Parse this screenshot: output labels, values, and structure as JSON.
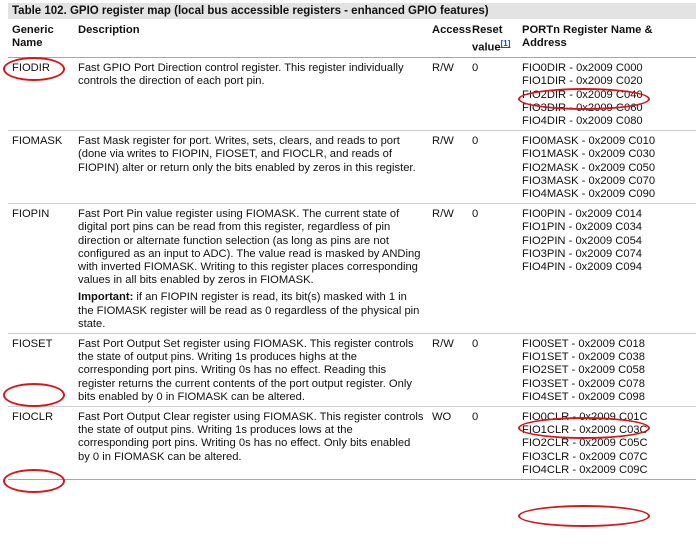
{
  "caption": "Table 102.  GPIO register map (local bus accessible registers - enhanced GPIO features)",
  "headers": {
    "generic_name": "Generic Name",
    "description": "Description",
    "access": "Access",
    "reset_value": "Reset value",
    "reset_ref": "[1]",
    "port_register": "PORTn Register Name & Address"
  },
  "rows": [
    {
      "name": "FIODIR",
      "description": [
        "Fast GPIO Port Direction control register. This register individually controls the direction of each port pin."
      ],
      "important": "",
      "important_text": "",
      "access": "R/W",
      "reset": "0",
      "addresses": [
        "FIO0DIR - 0x2009 C000",
        "FIO1DIR - 0x2009 C020",
        "FIO2DIR - 0x2009 C040",
        "FIO3DIR - 0x2009 C060",
        "FIO4DIR - 0x2009 C080"
      ]
    },
    {
      "name": "FIOMASK",
      "description": [
        "Fast Mask register for port. Writes, sets, clears, and reads to port (done via writes to FIOPIN, FIOSET, and FIOCLR, and reads of FIOPIN) alter or return only the bits enabled by zeros in this register."
      ],
      "important": "",
      "important_text": "",
      "access": "R/W",
      "reset": "0",
      "addresses": [
        "FIO0MASK - 0x2009 C010",
        "FIO1MASK - 0x2009 C030",
        "FIO2MASK - 0x2009 C050",
        "FIO3MASK - 0x2009 C070",
        "FIO4MASK - 0x2009 C090"
      ]
    },
    {
      "name": "FIOPIN",
      "description": [
        "Fast Port Pin value register using FIOMASK. The current state of digital port pins can be read from this register, regardless of pin direction or alternate function selection (as long as pins are not configured as an input to ADC). The value read is masked by ANDing with inverted FIOMASK. Writing to this register places corresponding values in all bits enabled by zeros in FIOMASK."
      ],
      "important": "Important:",
      "important_text": " if an FIOPIN register is read, its bit(s) masked with 1 in the FIOMASK register will be read as 0 regardless of the physical pin state.",
      "access": "R/W",
      "reset": "0",
      "addresses": [
        "FIO0PIN - 0x2009 C014",
        "FIO1PIN - 0x2009 C034",
        "FIO2PIN - 0x2009 C054",
        "FIO3PIN - 0x2009 C074",
        "FIO4PIN - 0x2009 C094"
      ]
    },
    {
      "name": "FIOSET",
      "description": [
        "Fast Port Output Set register using FIOMASK. This register controls the state of output pins. Writing 1s produces highs at the corresponding port pins. Writing 0s has no effect. Reading this register returns the current contents of the port output register. Only bits enabled by 0 in FIOMASK can be altered."
      ],
      "important": "",
      "important_text": "",
      "access": "R/W",
      "reset": "0",
      "addresses": [
        "FIO0SET - 0x2009 C018",
        "FIO1SET - 0x2009 C038",
        "FIO2SET - 0x2009 C058",
        "FIO3SET - 0x2009 C078",
        "FIO4SET - 0x2009 C098"
      ]
    },
    {
      "name": "FIOCLR",
      "description": [
        "Fast Port Output Clear register using FIOMASK. This register controls the state of output pins. Writing 1s produces lows at the corresponding port pins. Writing 0s has no effect. Only bits enabled by 0 in FIOMASK can be altered."
      ],
      "important": "",
      "important_text": "",
      "access": "WO",
      "reset": "0",
      "addresses": [
        "FIO0CLR - 0x2009 C01C",
        "FIO1CLR - 0x2009 C03C",
        "FIO2CLR - 0x2009 C05C",
        "FIO3CLR - 0x2009 C07C",
        "FIO4CLR - 0x2009 C09C"
      ]
    }
  ],
  "annotation_color": "#d6161b"
}
